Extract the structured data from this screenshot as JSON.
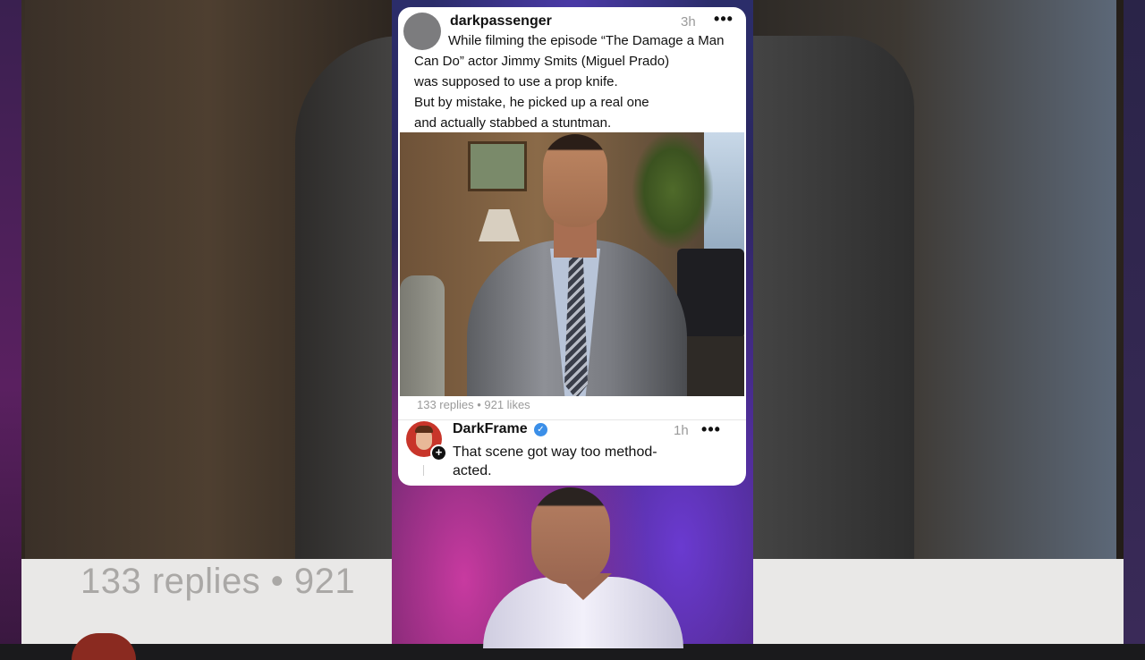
{
  "background": {
    "counts_text": "133 replies  •  921"
  },
  "post": {
    "username": "darkpassenger",
    "time": "3h",
    "more_icon": "more-horizontal-icon",
    "text_lines": [
      "While filming the episode “The Damage a Man",
      "Can Do” actor Jimmy Smits (Miguel Prado)",
      "was supposed to use a prop knife.",
      "But by mistake, he picked up a real one",
      "and actually stabbed a stuntman."
    ],
    "counts": "133 replies • 921 likes"
  },
  "reply": {
    "username": "DarkFrame",
    "verified_icon": "verified-badge-icon",
    "time": "1h",
    "more_icon": "more-horizontal-icon",
    "text_lines": [
      "That scene got way too method-",
      "acted."
    ]
  },
  "colors": {
    "verified": "#3b8fe8",
    "meta_text": "#9a9a9a"
  }
}
